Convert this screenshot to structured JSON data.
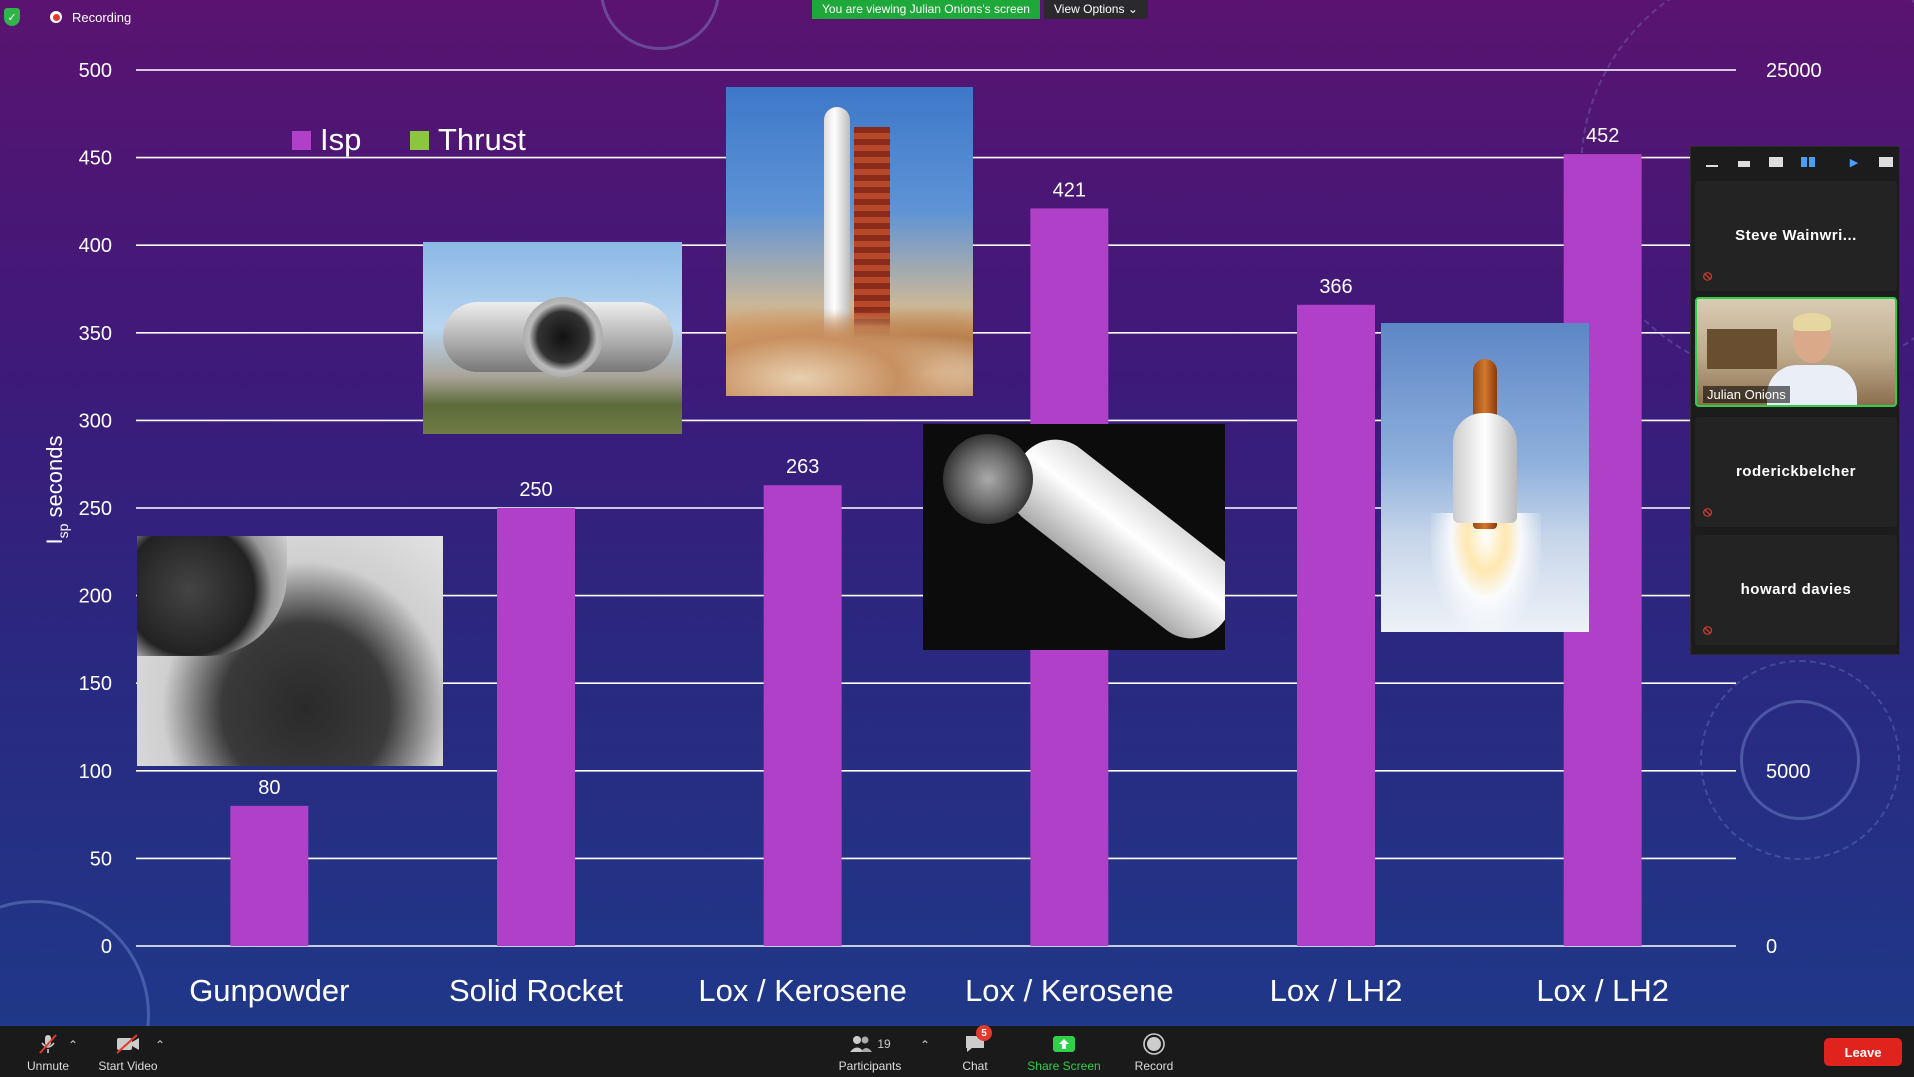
{
  "meeting": {
    "recording_label": "Recording",
    "viewing_banner": "You are viewing Julian Onions's screen",
    "view_options_label": "View Options"
  },
  "chart_data": {
    "type": "bar",
    "categories": [
      "Gunpowder",
      "Solid Rocket",
      "Lox / Kerosene",
      "Lox / Kerosene",
      "Lox / LH2",
      "Lox / LH2"
    ],
    "series": [
      {
        "name": "Isp",
        "color": "#b040c8",
        "values": [
          80,
          250,
          263,
          421,
          366,
          452
        ]
      },
      {
        "name": "Thrust",
        "color": "#8cc63f",
        "values": []
      }
    ],
    "data_labels": [
      "80",
      "250",
      "263",
      "421",
      "366",
      "452"
    ],
    "ylabel_main": "I",
    "ylabel_sub": "sp",
    "ylabel_rest": " seconds",
    "ylim": [
      0,
      500
    ],
    "y_ticks": [
      0,
      50,
      100,
      150,
      200,
      250,
      300,
      350,
      400,
      450,
      500
    ],
    "y2_ticks": [
      {
        "label": "25000",
        "at": 500
      },
      {
        "label": "5000",
        "at": 100
      },
      {
        "label": "0",
        "at": 0
      }
    ],
    "grid": true,
    "legend_position": "top-left"
  },
  "photos": {
    "gunpowder": "gunpowder-photo",
    "srb": "solid-rocket-booster-photo",
    "saturn": "saturn-v-launch-photo",
    "stage": "rocket-stage-photo",
    "shuttle": "space-shuttle-launch-photo"
  },
  "participants_panel": {
    "tiles": [
      {
        "name": "Steve Wainwri...",
        "muted": true
      },
      {
        "name": "Julian Onions",
        "video": true
      },
      {
        "name": "roderickbelcher",
        "muted": true
      },
      {
        "name": "howard davies",
        "muted": true
      }
    ]
  },
  "toolbar": {
    "unmute": "Unmute",
    "start_video": "Start Video",
    "participants": "Participants",
    "participants_count": "19",
    "chat": "Chat",
    "chat_badge": "5",
    "share_screen": "Share Screen",
    "record": "Record",
    "leave": "Leave"
  },
  "colors": {
    "isp": "#b040c8",
    "thrust": "#8cc63f",
    "share_green": "#2fcf4a",
    "leave_red": "#e0231d"
  }
}
